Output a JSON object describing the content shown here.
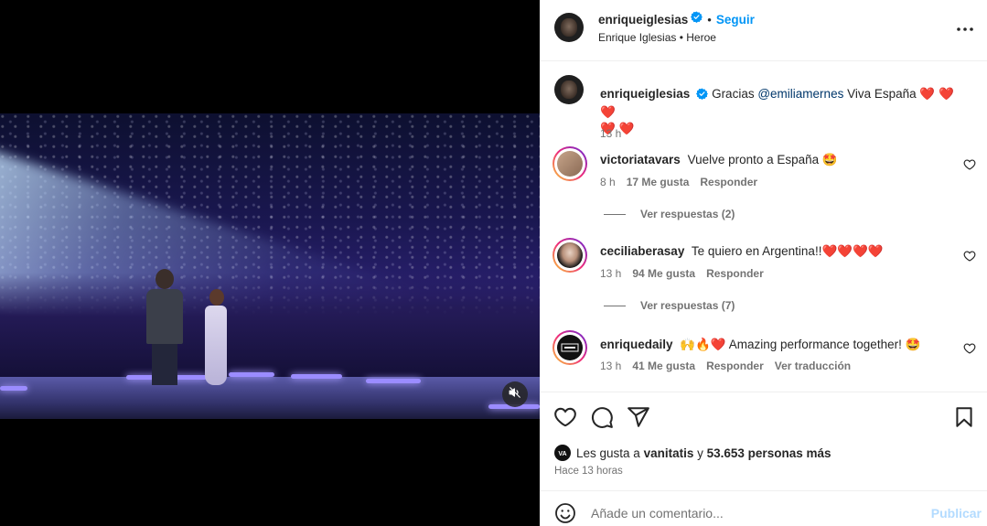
{
  "post": {
    "header": {
      "username": "enriqueiglesias",
      "follow_label": "Seguir",
      "separator": "•",
      "subtitle": "Enrique Iglesias • Heroe",
      "more_icon": "more-horizontal-icon"
    },
    "caption": {
      "username": "enriqueiglesias",
      "text_before": "Gracias",
      "mention": "@emiliamernes",
      "text_after": "Viva España",
      "hearts_line1": "❤️ ❤️ ❤️",
      "hearts_line2": "❤️ ❤️",
      "time": "13 h"
    },
    "comments": [
      {
        "username": "victoriatavars",
        "text": "Vuelve pronto a España 🤩",
        "time": "8 h",
        "likes": "17 Me gusta",
        "reply_label": "Responder",
        "view_replies": "Ver respuestas (2)"
      },
      {
        "username": "ceciliaberasay",
        "text": "Te quiero en Argentina!!❤️❤️❤️❤️",
        "time": "13 h",
        "likes": "94 Me gusta",
        "reply_label": "Responder",
        "view_replies": "Ver respuestas (7)"
      },
      {
        "username": "enriquedaily",
        "text": "🙌🔥❤️ Amazing performance together! 🤩",
        "time": "13 h",
        "likes": "41 Me gusta",
        "reply_label": "Responder",
        "translate_label": "Ver traducción"
      }
    ],
    "likes": {
      "prefix": "Les gusta a",
      "user": "vanitatis",
      "conjunction": "y",
      "others": "53.653 personas más",
      "time_ago": "Hace 13 horas"
    },
    "add_comment": {
      "placeholder": "Añade un comentario...",
      "post_label": "Publicar"
    }
  },
  "colors": {
    "accent": "#0095f6",
    "verified": "#0095f6",
    "heart": "#ed1c3a",
    "muted_text": "#737373",
    "post_disabled": "#b3dbff"
  }
}
